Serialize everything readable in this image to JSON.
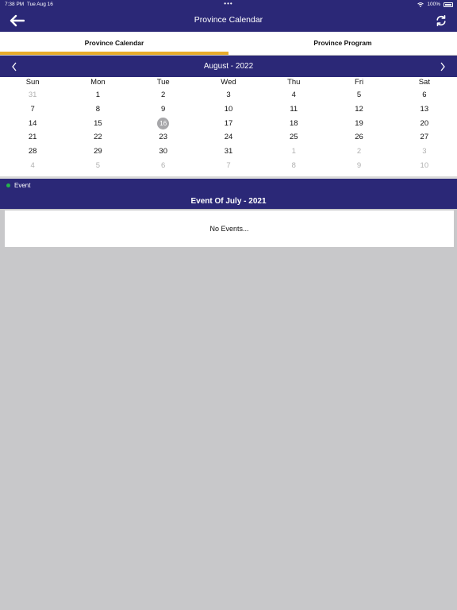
{
  "status_bar": {
    "time": "7:38 PM",
    "date": "Tue Aug 16",
    "battery": "100%"
  },
  "nav": {
    "title": "Province Calendar"
  },
  "tabs": [
    {
      "label": "Province Calendar",
      "active": true
    },
    {
      "label": "Province Program",
      "active": false
    }
  ],
  "calendar": {
    "month_label": "August - 2022",
    "weekdays": [
      "Sun",
      "Mon",
      "Tue",
      "Wed",
      "Thu",
      "Fri",
      "Sat"
    ],
    "days": [
      {
        "d": "31",
        "muted": true
      },
      {
        "d": "1"
      },
      {
        "d": "2"
      },
      {
        "d": "3"
      },
      {
        "d": "4"
      },
      {
        "d": "5"
      },
      {
        "d": "6"
      },
      {
        "d": "7"
      },
      {
        "d": "8"
      },
      {
        "d": "9"
      },
      {
        "d": "10"
      },
      {
        "d": "11"
      },
      {
        "d": "12"
      },
      {
        "d": "13"
      },
      {
        "d": "14"
      },
      {
        "d": "15"
      },
      {
        "d": "16",
        "today": true
      },
      {
        "d": "17"
      },
      {
        "d": "18"
      },
      {
        "d": "19"
      },
      {
        "d": "20"
      },
      {
        "d": "21"
      },
      {
        "d": "22"
      },
      {
        "d": "23"
      },
      {
        "d": "24"
      },
      {
        "d": "25"
      },
      {
        "d": "26"
      },
      {
        "d": "27"
      },
      {
        "d": "28"
      },
      {
        "d": "29"
      },
      {
        "d": "30"
      },
      {
        "d": "31"
      },
      {
        "d": "1",
        "muted": true
      },
      {
        "d": "2",
        "muted": true
      },
      {
        "d": "3",
        "muted": true
      },
      {
        "d": "4",
        "muted": true
      },
      {
        "d": "5",
        "muted": true
      },
      {
        "d": "6",
        "muted": true
      },
      {
        "d": "7",
        "muted": true
      },
      {
        "d": "8",
        "muted": true
      },
      {
        "d": "9",
        "muted": true
      },
      {
        "d": "10",
        "muted": true
      }
    ]
  },
  "events": {
    "legend_label": "Event",
    "legend_color": "#24b34b",
    "title": "Event Of July - 2021",
    "empty_text": "No Events..."
  },
  "colors": {
    "primary": "#2b2877",
    "accent": "#e8ac2a",
    "today_circle": "#a7a7aa",
    "background": "#c8c8ca"
  },
  "icons": {
    "back": "arrow-left-icon",
    "refresh": "refresh-icon",
    "prev": "chevron-left-icon",
    "next": "chevron-right-icon"
  }
}
